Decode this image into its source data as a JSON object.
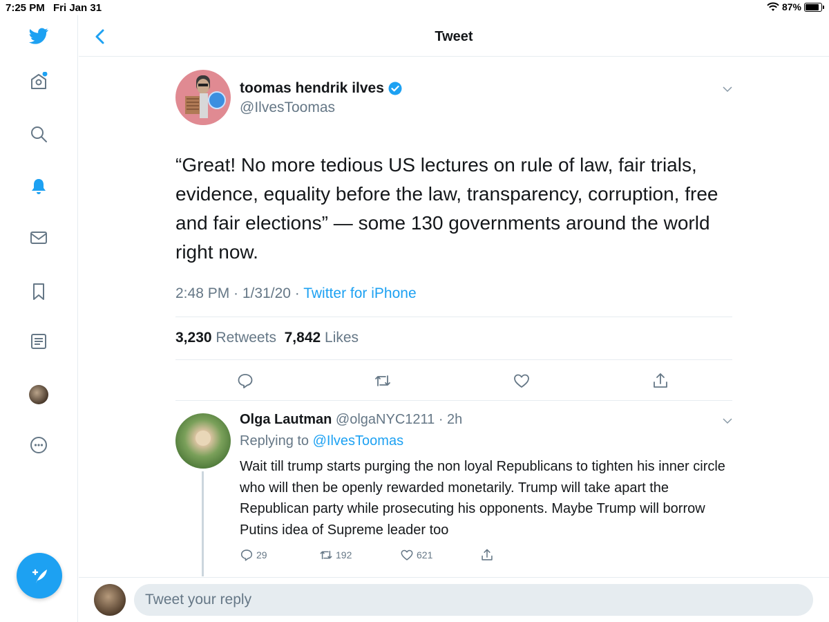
{
  "status_bar": {
    "time": "7:25 PM",
    "date": "Fri Jan 31",
    "battery": "87%",
    "battery_level": 0.87
  },
  "sidebar": {
    "items": [
      {
        "icon": "twitter-logo-icon"
      },
      {
        "icon": "home-icon"
      },
      {
        "icon": "search-icon"
      },
      {
        "icon": "bell-icon"
      },
      {
        "icon": "mail-icon"
      },
      {
        "icon": "bookmark-icon"
      },
      {
        "icon": "list-icon"
      },
      {
        "icon": "profile-avatar"
      },
      {
        "icon": "more-icon"
      }
    ],
    "compose_icon": "feather-icon"
  },
  "header": {
    "title": "Tweet"
  },
  "tweet": {
    "author_name": "toomas hendrik ilves",
    "author_handle": "@IlvesToomas",
    "text": "“Great! No more tedious US lectures on rule of law, fair trials, evidence, equality before the law, transparency, corruption, free and fair elections” — some 130 governments around the world right now.",
    "time": "2:48 PM · 1/31/20 · ",
    "client": "Twitter for iPhone",
    "retweets_count": "3,230",
    "retweets_label": "Retweets",
    "likes_count": "7,842",
    "likes_label": "Likes"
  },
  "reply": {
    "name": "Olga Lautman",
    "handle_time": "@olgaNYC1211 · 2h",
    "replying_prefix": "Replying to",
    "replying_to": "@IlvesToomas",
    "text": "Wait till trump starts purging the non loyal Republicans to tighten his inner circle who will then be openly rewarded monetarily. Trump will take apart the Republican party while prosecuting his opponents. Maybe Trump will borrow Putins idea of Supreme leader too",
    "replies": "29",
    "retweets": "192",
    "likes": "621"
  },
  "reply_bar": {
    "placeholder": "Tweet your reply"
  },
  "colors": {
    "accent": "#1da1f2",
    "secondary_text": "#657786",
    "divider": "#e6ecf0"
  }
}
